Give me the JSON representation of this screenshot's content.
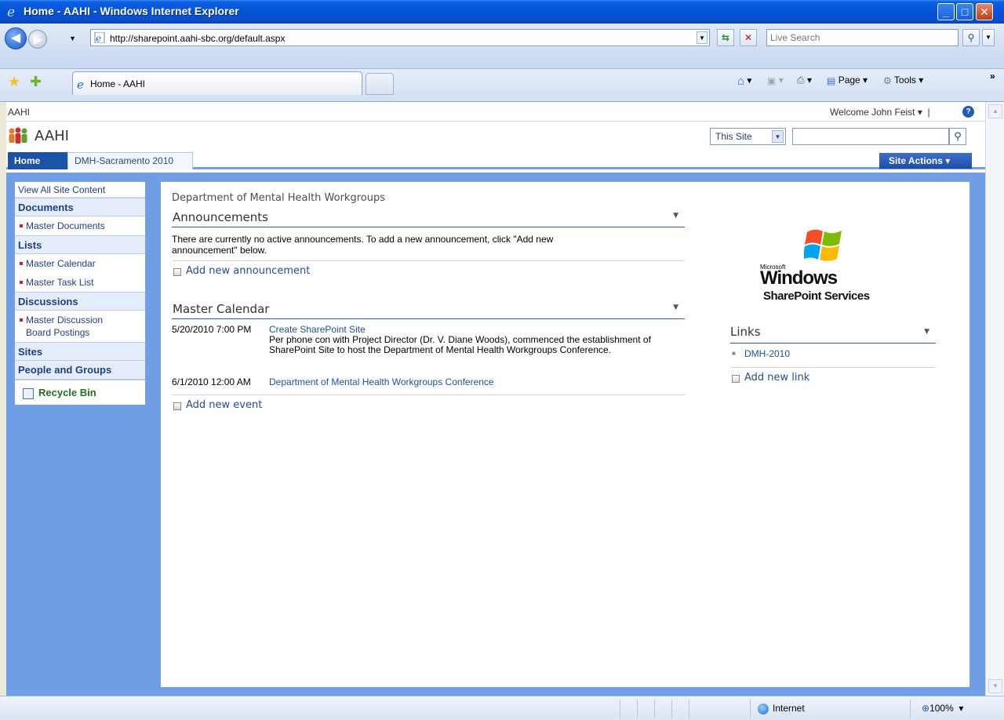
{
  "window": {
    "title": "Home - AAHI - Windows Internet Explorer"
  },
  "browser": {
    "url": "http://sharepoint.aahi-sbc.org/default.aspx",
    "search_placeholder": "Live Search",
    "tab_label": "Home - AAHI",
    "commands": {
      "page": "Page",
      "tools": "Tools"
    }
  },
  "sharepoint": {
    "breadcrumb": "AAHI",
    "welcome": "Welcome John Feist",
    "site_name": "AAHI",
    "search_scope": "This Site",
    "tabs": [
      "Home",
      "DMH-Sacramento 2010"
    ],
    "site_actions": "Site Actions"
  },
  "quick_launch": {
    "view_all": "View All Site Content",
    "documents": "Documents",
    "master_documents": "Master Documents",
    "lists": "Lists",
    "master_calendar": "Master Calendar",
    "master_task_list": "Master Task List",
    "discussions": "Discussions",
    "master_discussion": "Master Discussion Board Postings",
    "sites": "Sites",
    "people_groups": "People and Groups",
    "recycle_bin": "Recycle Bin"
  },
  "main": {
    "page_title": "Department of Mental Health Workgroups",
    "announcements": {
      "title": "Announcements",
      "empty_text": "There are currently no active announcements. To add a new announcement, click \"Add new announcement\" below.",
      "add_link": "Add new announcement"
    },
    "calendar": {
      "title": "Master Calendar",
      "events": [
        {
          "date": "5/20/2010 7:00 PM",
          "title": "Create SharePoint Site",
          "description": "Per phone con with Project Director (Dr. V. Diane Woods), commenced the establishment of SharePoint Site to host the Department of Mental Health Workgroups Conference."
        },
        {
          "date": "6/1/2010 12:00 AM",
          "title": "Department of Mental Health Workgroups Conference",
          "description": ""
        }
      ],
      "add_link": "Add new event"
    },
    "logo": {
      "microsoft": "Microsoft",
      "windows": "Windows",
      "sharepoint_services": "SharePoint Services"
    },
    "links": {
      "title": "Links",
      "items": [
        "DMH-2010"
      ],
      "add_link": "Add new link"
    }
  },
  "status": {
    "zone": "Internet",
    "zoom": "100%"
  }
}
